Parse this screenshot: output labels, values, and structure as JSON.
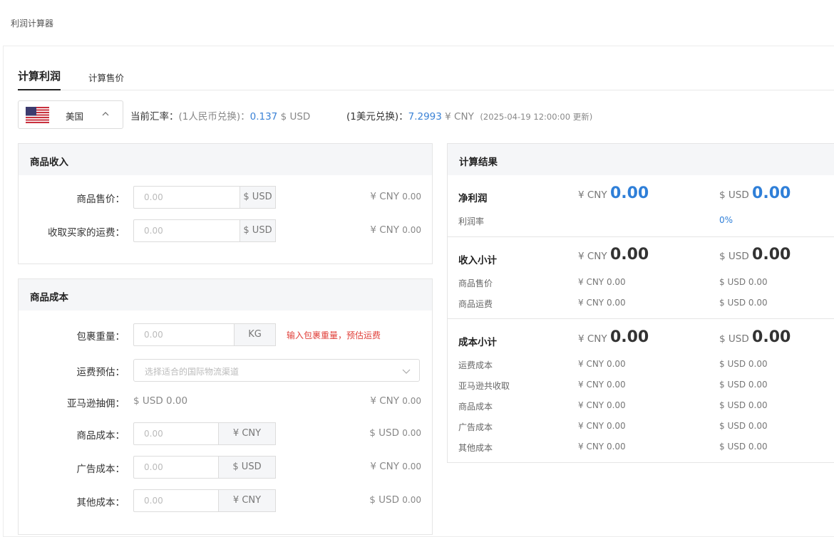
{
  "header": {
    "title": "利润计算器"
  },
  "tabs": [
    {
      "label": "计算利润"
    },
    {
      "label": "计算售价"
    }
  ],
  "country": {
    "name": "美国",
    "flag_icon": "us-flag-icon"
  },
  "rate": {
    "current_label": "当前汇率：",
    "cny_to_usd_label": "(1人民币兑换)：",
    "cny_to_usd_value": "0.137",
    "cny_to_usd_unit": "$ USD",
    "usd_to_cny_label": "(1美元兑换)：",
    "usd_to_cny_value": "7.2993",
    "usd_to_cny_unit": "¥ CNY",
    "updated": "(2025-04-19 12:00:00 更新)"
  },
  "income": {
    "title": "商品收入",
    "rows": [
      {
        "label": "商品售价：",
        "placeholder": "0.00",
        "suffix": "$ USD",
        "side_cur": "¥ CNY",
        "side_val": "0.00"
      },
      {
        "label": "收取买家的运费：",
        "placeholder": "0.00",
        "suffix": "$ USD",
        "side_cur": "¥ CNY",
        "side_val": "0.00"
      }
    ]
  },
  "cost": {
    "title": "商品成本",
    "weight": {
      "label": "包裹重量：",
      "placeholder": "0.00",
      "suffix": "KG",
      "warning": "输入包裹重量，预估运费"
    },
    "shipping": {
      "label": "运费预估：",
      "placeholder": "选择适合的国际物流渠道"
    },
    "commission": {
      "label": "亚马逊抽佣：",
      "value": "$ USD 0.00",
      "side_cur": "¥ CNY",
      "side_val": "0.00"
    },
    "rows": [
      {
        "label": "商品成本：",
        "placeholder": "0.00",
        "suffix": "¥ CNY",
        "side_cur": "$ USD",
        "side_val": "0.00"
      },
      {
        "label": "广告成本：",
        "placeholder": "0.00",
        "suffix": "$ USD",
        "side_cur": "¥ CNY",
        "side_val": "0.00"
      },
      {
        "label": "其他成本：",
        "placeholder": "0.00",
        "suffix": "¥ CNY",
        "side_cur": "$ USD",
        "side_val": "0.00"
      }
    ]
  },
  "result": {
    "title": "计算结果",
    "net": {
      "label": "净利润",
      "cny_cur": "¥ CNY",
      "cny_val": "0.00",
      "usd_cur": "$ USD",
      "usd_val": "0.00",
      "margin_label": "利润率",
      "margin_val": "0%"
    },
    "income": {
      "label": "收入小计",
      "cny_cur": "¥ CNY",
      "cny_val": "0.00",
      "usd_cur": "$ USD",
      "usd_val": "0.00",
      "items": [
        {
          "label": "商品售价",
          "cny": "¥ CNY 0.00",
          "usd": "$ USD 0.00"
        },
        {
          "label": "商品运费",
          "cny": "¥ CNY 0.00",
          "usd": "$ USD 0.00"
        }
      ]
    },
    "cost": {
      "label": "成本小计",
      "cny_cur": "¥ CNY",
      "cny_val": "0.00",
      "usd_cur": "$ USD",
      "usd_val": "0.00",
      "items": [
        {
          "label": "运费成本",
          "cny": "¥ CNY 0.00",
          "usd": "$ USD 0.00"
        },
        {
          "label": "亚马逊共收取",
          "cny": "¥ CNY 0.00",
          "usd": "$ USD 0.00"
        },
        {
          "label": "商品成本",
          "cny": "¥ CNY 0.00",
          "usd": "$ USD 0.00"
        },
        {
          "label": "广告成本",
          "cny": "¥ CNY 0.00",
          "usd": "$ USD 0.00"
        },
        {
          "label": "其他成本",
          "cny": "¥ CNY 0.00",
          "usd": "$ USD 0.00"
        }
      ]
    }
  },
  "colors": {
    "accent": "#2f7fd8",
    "warning": "#e0403a",
    "panel_header": "#f5f6f8"
  }
}
